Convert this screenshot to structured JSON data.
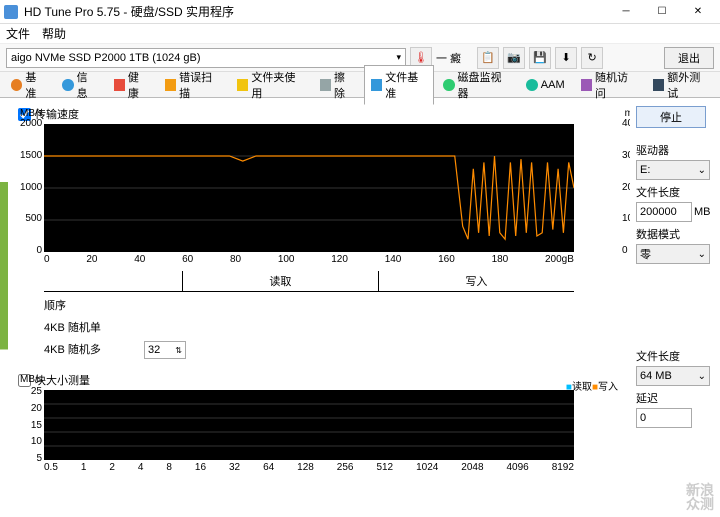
{
  "title": "HD Tune Pro 5.75 - 硬盘/SSD 实用程序",
  "menu": {
    "file": "文件",
    "help": "帮助"
  },
  "drive": "aigo NVMe SSD P2000 1TB (1024 gB)",
  "temp_label": "一 癜",
  "exit": "退出",
  "tabs": {
    "benchmark": "基准",
    "info": "信息",
    "health": "健康",
    "errorscan": "错误扫描",
    "folder": "文件夹使用",
    "erase": "擦除",
    "filebench": "文件基准",
    "diskmon": "磁盘监视器",
    "aam": "AAM",
    "random": "随机访问",
    "extra": "额外测试"
  },
  "check_transfer": "传输速度",
  "chart1": {
    "unit_l": "MB/s",
    "unit_r": "ms",
    "y": [
      "2000",
      "1500",
      "1000",
      "500",
      "0"
    ],
    "y2": [
      "40",
      "30",
      "20",
      "10",
      "0"
    ],
    "x": [
      "0",
      "20",
      "40",
      "60",
      "80",
      "100",
      "120",
      "140",
      "160",
      "180",
      "200gB"
    ]
  },
  "rw": {
    "read": "读取",
    "write": "写入"
  },
  "rows": {
    "seq": "顺序",
    "r4k1": "4KB 随机单",
    "r4kn": "4KB 随机多",
    "threads": "32"
  },
  "check_block": "块大小测量",
  "chart2": {
    "unit": "MB/s",
    "y": [
      "25",
      "20",
      "15",
      "10",
      "5"
    ],
    "x": [
      "0.5",
      "1",
      "2",
      "4",
      "8",
      "16",
      "32",
      "64",
      "128",
      "256",
      "512",
      "1024",
      "2048",
      "4096",
      "8192"
    ],
    "legend_r": "读取",
    "legend_w": "写入"
  },
  "panel": {
    "stop": "停止",
    "drive_l": "驱动器",
    "drive_v": "E:",
    "len_l": "文件长度",
    "len_v": "200000",
    "mb": "MB",
    "mode_l": "数据模式",
    "mode_v": "零",
    "len2_l": "文件长度",
    "len2_v": "64 MB",
    "delay_l": "延迟",
    "delay_v": "0"
  },
  "watermark": {
    "l1": "新浪",
    "l2": "众测"
  },
  "chart_data": {
    "type": "line",
    "title": "传输速度",
    "xlabel": "gB",
    "ylabel": "MB/s",
    "y2label": "ms",
    "xlim": [
      0,
      200
    ],
    "ylim": [
      0,
      2000
    ],
    "y2lim": [
      0,
      40
    ],
    "series": [
      {
        "name": "transfer_rate",
        "color": "#ff8c00",
        "unit": "MB/s",
        "x": [
          0,
          10,
          20,
          30,
          40,
          50,
          60,
          70,
          75,
          80,
          90,
          100,
          110,
          120,
          130,
          140,
          150,
          155,
          158,
          160,
          162,
          164,
          166,
          168,
          170,
          172,
          174,
          176,
          178,
          180,
          182,
          184,
          186,
          188,
          190,
          192,
          194,
          196,
          198,
          200
        ],
        "values": [
          1500,
          1500,
          1500,
          1500,
          1500,
          1500,
          1500,
          1500,
          1420,
          1500,
          1500,
          1500,
          1500,
          1500,
          1500,
          1500,
          1500,
          1500,
          400,
          200,
          1300,
          300,
          1400,
          250,
          1500,
          300,
          200,
          1400,
          250,
          1450,
          300,
          1400,
          250,
          300,
          1400,
          350,
          1300,
          300,
          1400,
          1000
        ]
      }
    ]
  }
}
